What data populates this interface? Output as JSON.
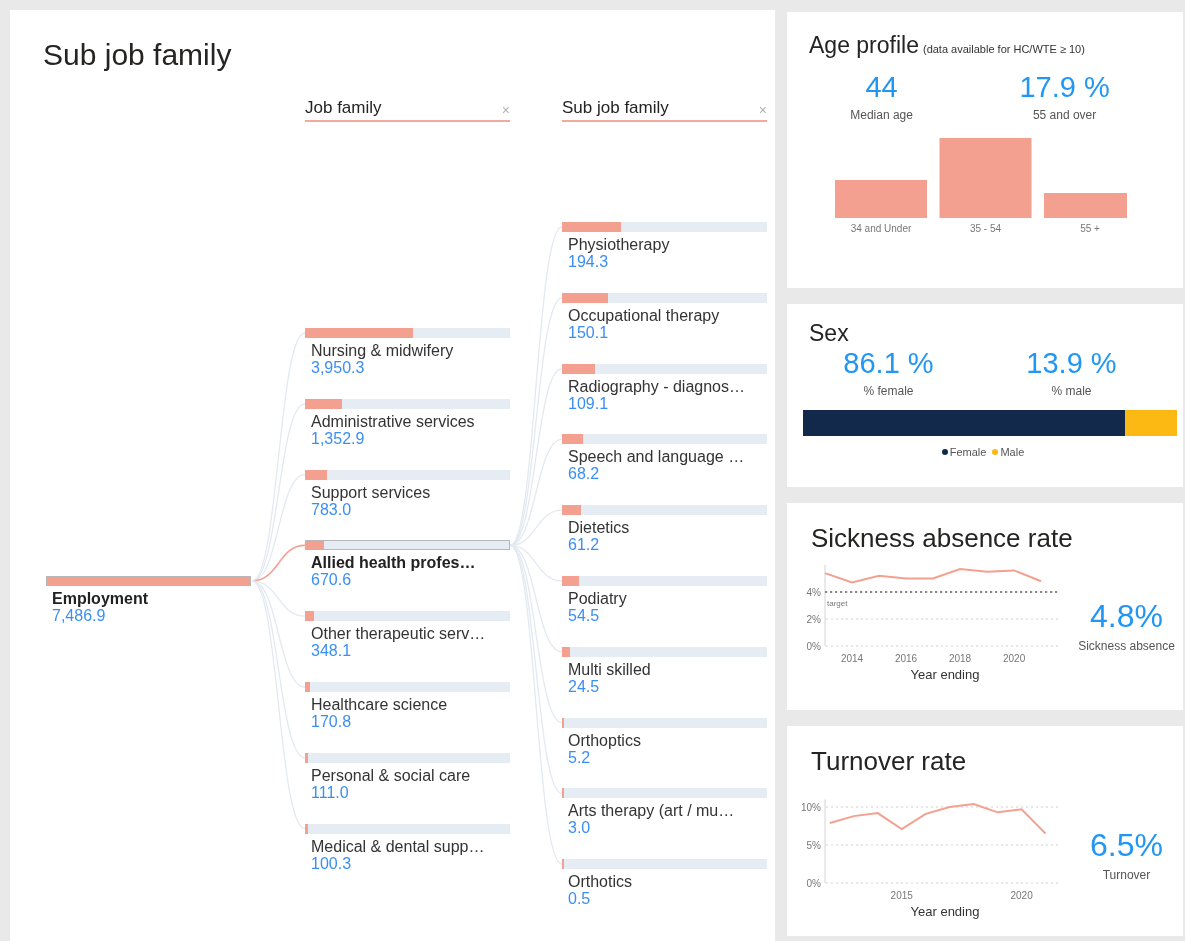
{
  "title": "Sub job family",
  "tree": {
    "columns": [
      {
        "label": "Job family",
        "clear": "×"
      },
      {
        "label": "Sub job family",
        "clear": "×"
      }
    ],
    "root": {
      "label": "Employment",
      "value": "7,486.9",
      "level": 1,
      "selected": true,
      "children": [
        {
          "label": "Nursing & midwifery",
          "value": "3,950.3",
          "level": 0.528,
          "selected": false
        },
        {
          "label": "Administrative services",
          "value": "1,352.9",
          "level": 0.181,
          "selected": false
        },
        {
          "label": "Support services",
          "value": "783.0",
          "level": 0.105,
          "selected": false
        },
        {
          "label": "Allied health profes…",
          "value": "670.6",
          "level": 0.09,
          "selected": true,
          "children": [
            {
              "label": "Physiotherapy",
              "value": "194.3",
              "level": 0.29,
              "selected": false
            },
            {
              "label": "Occupational therapy",
              "value": "150.1",
              "level": 0.224,
              "selected": false
            },
            {
              "label": "Radiography - diagnos…",
              "value": "109.1",
              "level": 0.163,
              "selected": false
            },
            {
              "label": "Speech and language …",
              "value": "68.2",
              "level": 0.102,
              "selected": false
            },
            {
              "label": "Dietetics",
              "value": "61.2",
              "level": 0.091,
              "selected": false
            },
            {
              "label": "Podiatry",
              "value": "54.5",
              "level": 0.081,
              "selected": false
            },
            {
              "label": "Multi skilled",
              "value": "24.5",
              "level": 0.037,
              "selected": false
            },
            {
              "label": "Orthoptics",
              "value": "5.2",
              "level": 0.008,
              "selected": false
            },
            {
              "label": "Arts therapy (art / mu…",
              "value": "3.0",
              "level": 0.004,
              "selected": false
            },
            {
              "label": "Orthotics",
              "value": "0.5",
              "level": 0.001,
              "selected": false
            }
          ]
        },
        {
          "label": "Other therapeutic serv…",
          "value": "348.1",
          "level": 0.046,
          "selected": false
        },
        {
          "label": "Healthcare science",
          "value": "170.8",
          "level": 0.023,
          "selected": false
        },
        {
          "label": "Personal & social care",
          "value": "111.0",
          "level": 0.015,
          "selected": false
        },
        {
          "label": "Medical & dental supp…",
          "value": "100.3",
          "level": 0.013,
          "selected": false
        }
      ]
    }
  },
  "age_profile": {
    "title": "Age profile",
    "note": "(data available for HC/WTE ≥ 10)",
    "kpis": [
      {
        "value": "44",
        "label": "Median age"
      },
      {
        "value": "17.9 %",
        "label": "55 and over"
      }
    ],
    "bands": [
      {
        "label": "34 and Under"
      },
      {
        "label": "35 - 54"
      },
      {
        "label": "55 +"
      }
    ]
  },
  "sex": {
    "title": "Sex",
    "kpis": [
      {
        "value": "86.1 %",
        "label": "% female"
      },
      {
        "value": "13.9 %",
        "label": "% male"
      }
    ],
    "segments": [
      {
        "name": "Female",
        "color": "#13294b",
        "level": 0.861
      },
      {
        "name": "Male",
        "color": "#fdb913"
      }
    ]
  },
  "sickness_absence": {
    "title": "Sickness absence rate",
    "kpi": {
      "value": "4.8%",
      "label": "Sickness absence"
    },
    "chart_data": {
      "type": "line",
      "xlabel": "Year ending",
      "x": [
        2013,
        2014,
        2015,
        2016,
        2017,
        2018,
        2019,
        2020,
        2021
      ],
      "series": [
        {
          "color": "#f4a090",
          "values": [
            5.4,
            4.7,
            5.2,
            5.0,
            5.0,
            5.7,
            5.5,
            5.6,
            4.8
          ]
        }
      ],
      "yticks": [
        {
          "value": 0,
          "label": "0%"
        },
        {
          "value": 2,
          "label": "2%"
        },
        {
          "value": 4,
          "label": "4%"
        }
      ],
      "xticks": [
        2014,
        2016,
        2018,
        2020
      ],
      "xlim": [
        2013,
        2021.7
      ],
      "ylim": [
        0,
        6
      ],
      "ref_lines": [
        {
          "axis": "y",
          "value": 4,
          "label": "target"
        }
      ]
    }
  },
  "turnover": {
    "title": "Turnover rate",
    "kpi": {
      "value": "6.5%",
      "label": "Turnover"
    },
    "chart_data": {
      "type": "line",
      "xlabel": "Year ending",
      "x": [
        2012,
        2013,
        2014,
        2015,
        2016,
        2017,
        2018,
        2019,
        2020,
        2021
      ],
      "series": [
        {
          "color": "#f4a090",
          "values": [
            7.9,
            8.8,
            9.2,
            7.1,
            9.1,
            10.0,
            10.4,
            9.3,
            9.7,
            6.5
          ]
        }
      ],
      "yticks": [
        {
          "value": 0,
          "label": "0%"
        },
        {
          "value": 5,
          "label": "5%"
        },
        {
          "value": 10,
          "label": "10%"
        }
      ],
      "xticks": [
        {
          "value": 2015,
          "label": "2015"
        },
        {
          "value": 2020,
          "label": "2020"
        }
      ],
      "xlim": [
        2011.8,
        2021.6
      ],
      "ylim": [
        0,
        11
      ]
    }
  }
}
